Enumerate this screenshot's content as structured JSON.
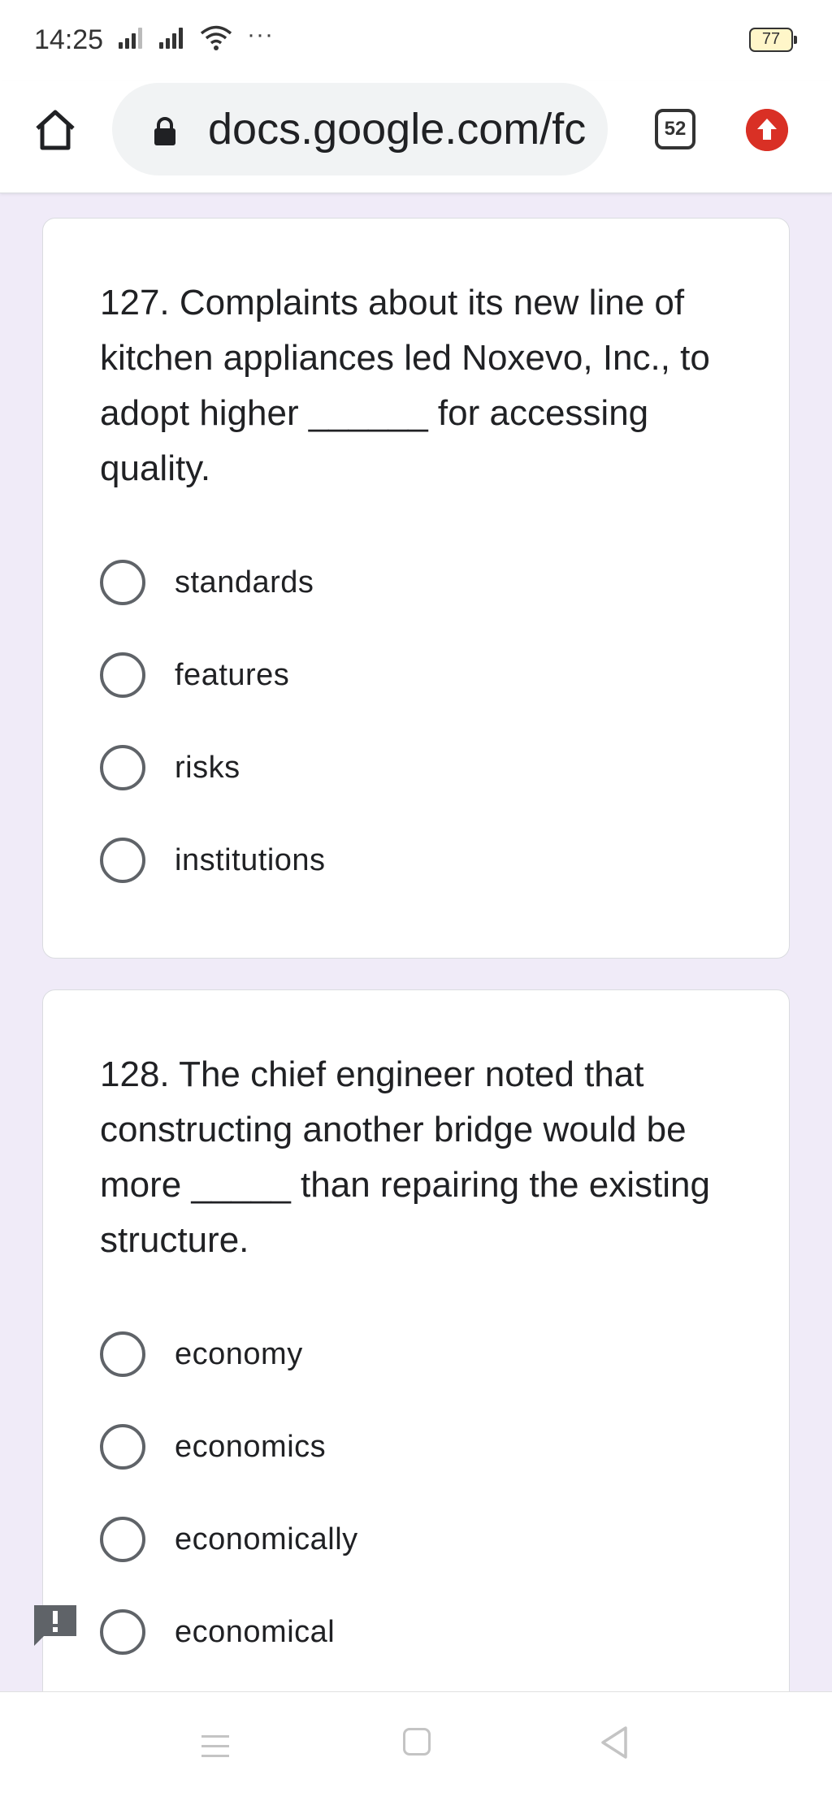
{
  "status_bar": {
    "time": "14:25",
    "more": "···",
    "battery": "77"
  },
  "browser": {
    "url": "docs.google.com/fc",
    "tab_count": "52",
    "colors": {
      "update": "#d93025",
      "pill": "#f1f3f4"
    }
  },
  "questions": [
    {
      "number": "127",
      "text": "127. Complaints about its new line of kitchen appliances led Noxevo, Inc., to adopt higher ______ for accessing quality.",
      "options": [
        "standards",
        "features",
        "risks",
        "institutions"
      ]
    },
    {
      "number": "128",
      "text": "128. The chief engineer noted that constructing another bridge would be more _____ than repairing the existing structure.",
      "options": [
        "economy",
        "economics",
        "economically",
        "economical"
      ]
    }
  ],
  "icons": {
    "home": "home-icon",
    "lock": "lock-icon",
    "update": "arrow-up-icon",
    "feedback": "feedback-icon",
    "nav_menu": "menu-icon",
    "nav_home": "square-icon",
    "nav_back": "back-triangle-icon"
  },
  "page": {
    "background": "#f0ebf8"
  }
}
